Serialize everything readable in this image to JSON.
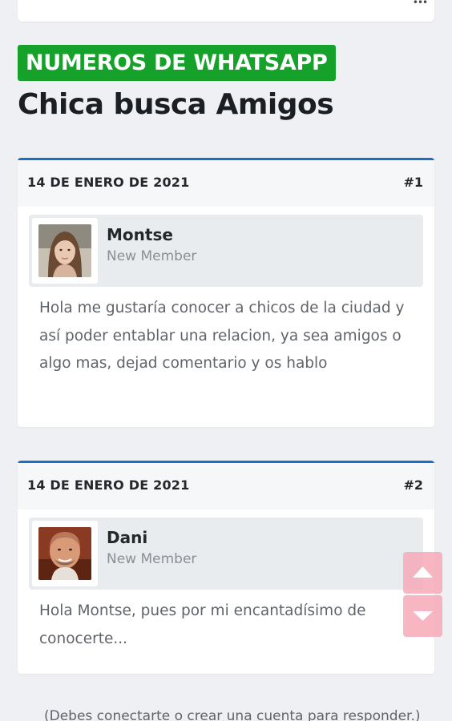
{
  "header": {
    "category": "NUMEROS DE WHATSAPP",
    "title": "Chica busca Amigos"
  },
  "posts": [
    {
      "date": "14 DE ENERO DE 2021",
      "number": "#1",
      "author": "Montse",
      "role": "New Member",
      "avatar": "woman-avatar",
      "body": "Hola me gustaría conocer a chicos de la ciudad y así poder entablar una relacion, ya sea amigos o algo mas, dejad comentario y os hablo"
    },
    {
      "date": "14 DE ENERO DE 2021",
      "number": "#2",
      "author": "Dani",
      "role": "New Member",
      "avatar": "man-avatar",
      "body": "Hola Montse, pues por mi encantadísimo de conocerte..."
    }
  ],
  "footer": {
    "login_note": "(Debes conectarte o crear una cuenta para responder.)"
  },
  "controls": {
    "scroll_up_icon": "arrow-up-icon",
    "scroll_down_icon": "arrow-down-icon"
  },
  "colors": {
    "badge": "#15a12a",
    "post_border": "#1a6fc4",
    "scroll_buttons": "#f6aab8"
  }
}
